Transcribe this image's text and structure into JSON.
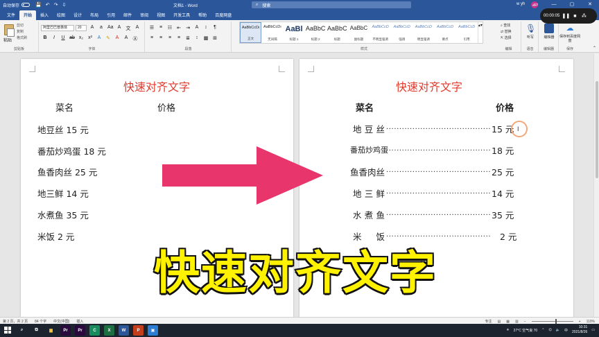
{
  "titlebar": {
    "autosave_label": "自动保存",
    "autosave_state": "关",
    "doc_title": "文档1 - Word",
    "search_placeholder": "搜索",
    "user_name": "w yh",
    "user_initials": "WY",
    "quick_access": [
      "💾",
      "↶",
      "↷",
      "⇩"
    ]
  },
  "recording": {
    "time": "00:00:05"
  },
  "menu": {
    "tabs": [
      "文件",
      "开始",
      "插入",
      "绘图",
      "设计",
      "布局",
      "引用",
      "邮件",
      "审阅",
      "视图",
      "开发工具",
      "帮助",
      "百度网盘"
    ],
    "active_index": 1
  },
  "ribbon": {
    "clipboard": {
      "paste": "粘贴",
      "items": [
        "剪切",
        "复制",
        "格式刷"
      ],
      "label": "剪贴板"
    },
    "font": {
      "name": "阿里巴巴普惠体",
      "size": "20",
      "label": "字体"
    },
    "paragraph": {
      "label": "段落"
    },
    "styles": {
      "label": "样式",
      "items": [
        {
          "sample": "AaBbCcDı",
          "name": "正文"
        },
        {
          "sample": "AaBbCcDı",
          "name": "无间隔"
        },
        {
          "sample": "AaBl",
          "name": "标题 1"
        },
        {
          "sample": "AaBbC",
          "name": "标题 2"
        },
        {
          "sample": "AaBbC",
          "name": "标题"
        },
        {
          "sample": "AaBbC",
          "name": "副标题"
        },
        {
          "sample": "AaBbCcD",
          "name": "不明显强调"
        },
        {
          "sample": "AaBbCcD",
          "name": "强调"
        },
        {
          "sample": "AaBbCcD",
          "name": "明显强调"
        },
        {
          "sample": "AaBbCcD",
          "name": "要点"
        },
        {
          "sample": "AaBbCcD",
          "name": "引用"
        }
      ]
    },
    "editing": {
      "items": [
        "查找",
        "替换",
        "选择"
      ],
      "label": "编辑"
    },
    "voice": {
      "button": "听写",
      "label": "语音"
    },
    "editor": {
      "button": "编辑器",
      "label": "编辑器"
    },
    "baidu": {
      "button": "保存到百度网盘",
      "label": "保存"
    }
  },
  "left_page": {
    "title": "快速对齐文字",
    "header_name": "菜名",
    "header_price": "价格",
    "lines": [
      "地豆丝 15 元",
      "番茄炒鸡蛋 18 元",
      "鱼香肉丝 25 元",
      "地三鲜 14 元",
      "水煮鱼 35 元",
      "米饭 2 元"
    ]
  },
  "right_page": {
    "title": "快速对齐文字",
    "header_name": "菜名",
    "header_price": "价格",
    "rows": [
      {
        "name": "地豆丝",
        "price": "15 元"
      },
      {
        "name": "番茄炒鸡蛋",
        "price": "18 元"
      },
      {
        "name": "鱼香肉丝",
        "price": "25 元"
      },
      {
        "name": "地三鲜",
        "price": "14 元"
      },
      {
        "name": "水煮鱼",
        "price": "35 元"
      },
      {
        "name": "米 饭",
        "price": "2 元"
      }
    ],
    "leader": "....................................................................."
  },
  "caption": "快速对齐文字",
  "statusbar": {
    "page": "第 2 页，共 2 页",
    "words": "84 个字",
    "lang": "中文(中国)",
    "mode": "插入",
    "focus": "专注",
    "zoom": "110%"
  },
  "taskbar": {
    "weather": "27°C 空气良 70",
    "time": "10:31",
    "date": "2021/8/26",
    "apps": [
      {
        "name": "PR",
        "label": "Pr",
        "color": "#2a0a3d"
      },
      {
        "name": "PR",
        "label": "Pr",
        "color": "#2a0a3d"
      },
      {
        "name": "CAM",
        "label": "C",
        "color": "#1a8b5c"
      },
      {
        "name": "EXCEL",
        "label": "X",
        "color": "#1d6f42"
      },
      {
        "name": "WORD",
        "label": "W",
        "color": "#2b579a"
      },
      {
        "name": "PPT",
        "label": "P",
        "color": "#c43e1c"
      },
      {
        "name": "MEET",
        "label": "▣",
        "color": "#2d7cd4"
      }
    ]
  },
  "colors": {
    "title_red": "#e03a2d",
    "word_blue": "#2b579a",
    "arrow_pink": "#e8356c",
    "caption_yellow": "#fff200"
  }
}
